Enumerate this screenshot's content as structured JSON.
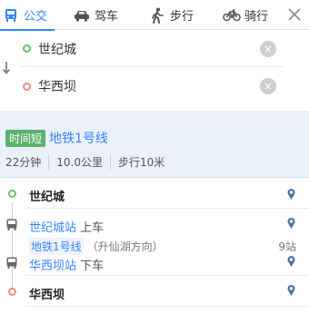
{
  "tabs": [
    {
      "label": "公交",
      "icon": "bus-icon",
      "active": true
    },
    {
      "label": "驾车",
      "icon": "car-icon",
      "active": false
    },
    {
      "label": "步行",
      "icon": "walk-icon",
      "active": false
    },
    {
      "label": "骑行",
      "icon": "bike-icon",
      "active": false
    }
  ],
  "search": {
    "start": "世纪城",
    "end": "华西坝"
  },
  "route": {
    "badge": "时间短",
    "line": "地铁1号线",
    "duration": "22分钟",
    "distance": "10.0公里",
    "walk": "步行10米"
  },
  "steps": {
    "start": "世纪城",
    "board_station": "世纪城站",
    "board_action": "上车",
    "line_tag": "地铁1号线",
    "direction": "（升仙湖方向）",
    "stops": "9站",
    "alight_station": "华西坝站",
    "alight_action": "下车",
    "end": "华西坝"
  },
  "colors": {
    "accent": "#3385ff",
    "badge": "#5bb26a",
    "start_dot": "#6dc26a",
    "end_dot": "#f28a8a",
    "card_bg": "#eaf1fb"
  }
}
